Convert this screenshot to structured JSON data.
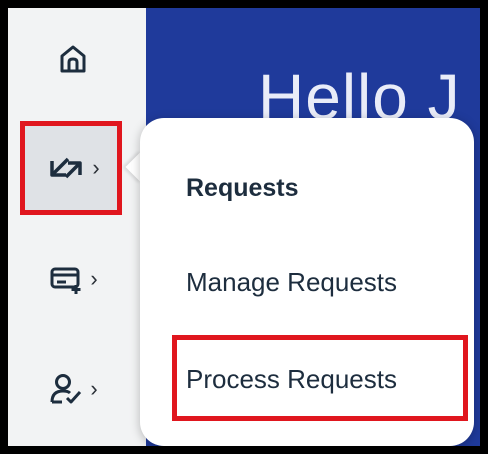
{
  "header": {
    "greeting": "Hello J"
  },
  "sidebar": {
    "items": [
      {
        "icon": "home-icon",
        "label": ""
      },
      {
        "icon": "requests-icon",
        "chevron": "›"
      },
      {
        "icon": "create-ticket-icon",
        "chevron": "›"
      },
      {
        "icon": "user-check-icon",
        "chevron": "›"
      }
    ]
  },
  "popover": {
    "title": "Requests",
    "items": [
      {
        "label": "Manage Requests"
      },
      {
        "label": "Process Requests"
      }
    ]
  },
  "colors": {
    "highlight": "#e0161e",
    "brand": "#1f3a9b",
    "text": "#1d2d3e"
  }
}
